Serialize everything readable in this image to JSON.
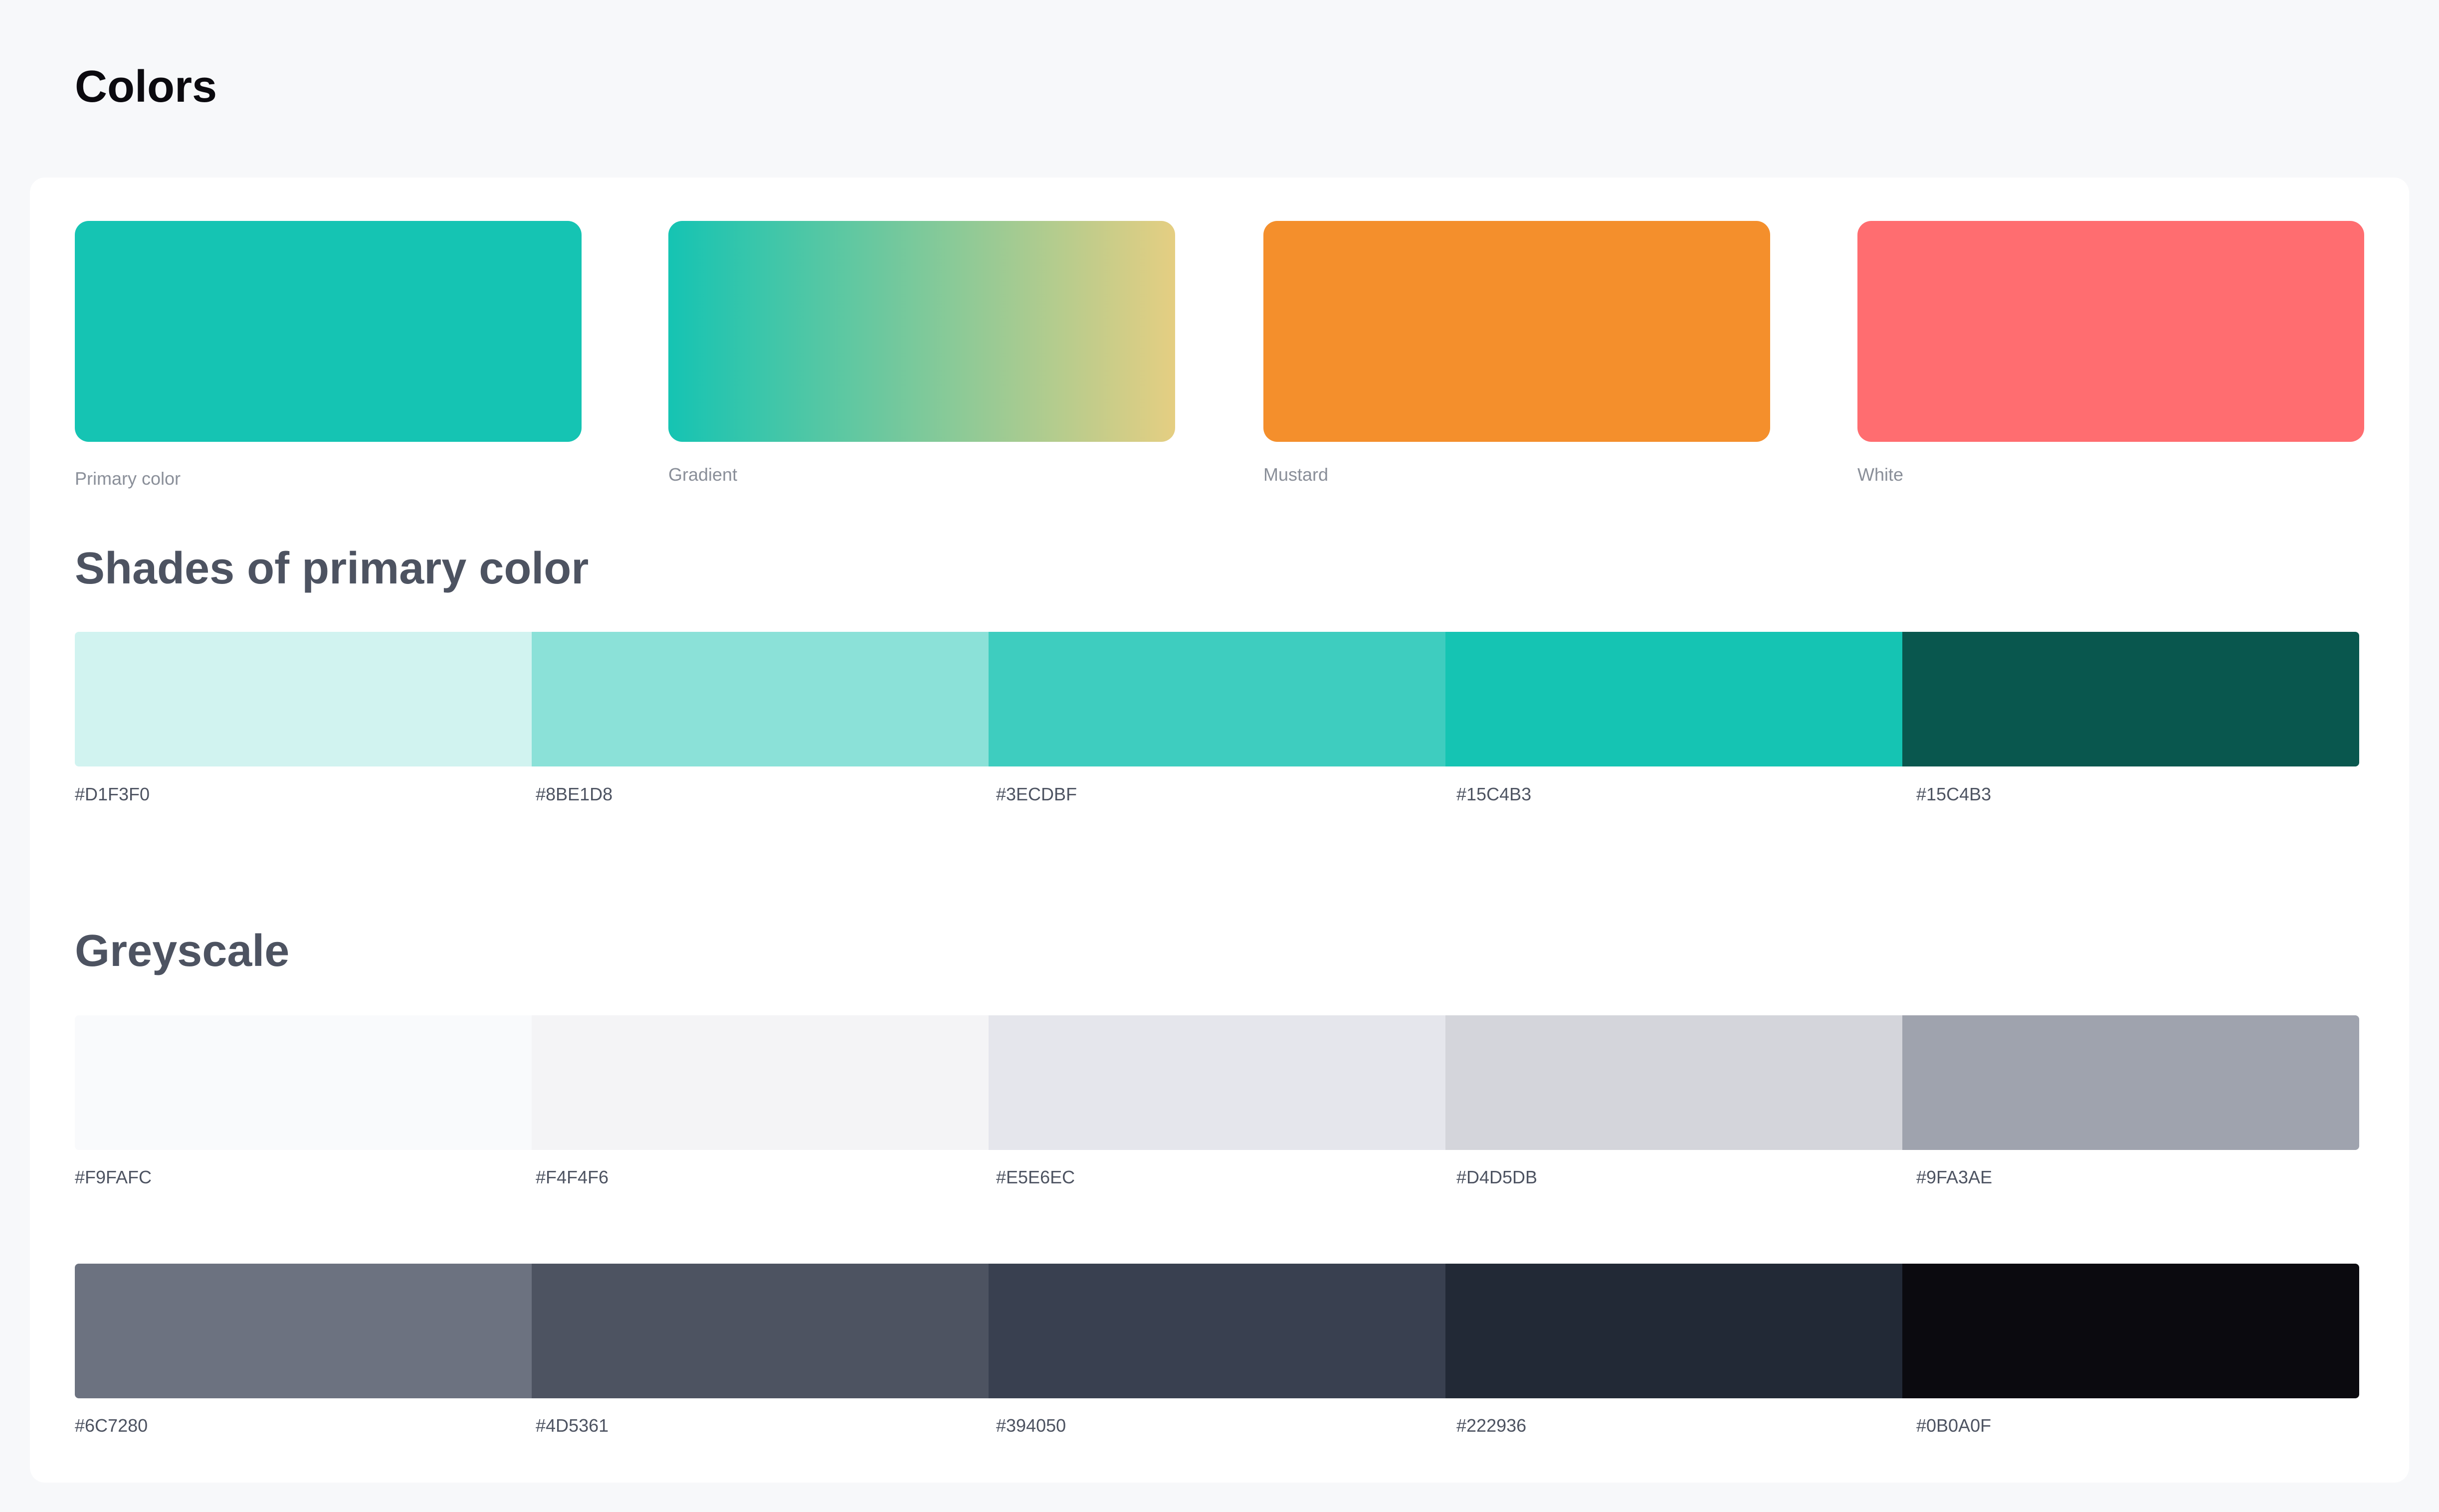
{
  "page": {
    "title": "Colors"
  },
  "main_colors": [
    {
      "label": "Primary color",
      "color": "#15C4B3"
    },
    {
      "label": "Gradient",
      "gradient_from": "#15C4B3",
      "gradient_to": "#E5CE82"
    },
    {
      "label": "Mustard",
      "color": "#F48F2C"
    },
    {
      "label": "White",
      "color": "#FF6D70"
    }
  ],
  "primary_shades": {
    "title": "Shades of primary color",
    "swatches": [
      {
        "label": "#D1F3F0",
        "color": "#D1F3F0"
      },
      {
        "label": "#8BE1D8",
        "color": "#8BE1D8"
      },
      {
        "label": "#3ECDBF",
        "color": "#3ECDBF"
      },
      {
        "label": "#15C4B3",
        "color": "#15C4B3"
      },
      {
        "label": "#15C4B3",
        "color": "#09574E"
      }
    ]
  },
  "greyscale": {
    "title": "Greyscale",
    "light_swatches": [
      {
        "label": "#F9FAFC",
        "color": "#F9FAFC"
      },
      {
        "label": "#F4F4F6",
        "color": "#F4F4F6"
      },
      {
        "label": "#E5E6EC",
        "color": "#E5E6EC"
      },
      {
        "label": "#D4D5DB",
        "color": "#D4D5DB"
      },
      {
        "label": "#9FA3AE",
        "color": "#9FA3AE"
      }
    ],
    "dark_swatches": [
      {
        "label": "#6C7280",
        "color": "#6C7280"
      },
      {
        "label": "#4D5361",
        "color": "#4D5361"
      },
      {
        "label": "#394050",
        "color": "#394050"
      },
      {
        "label": "#222936",
        "color": "#222936"
      },
      {
        "label": "#0B0A0F",
        "color": "#0B0A0F"
      }
    ]
  }
}
